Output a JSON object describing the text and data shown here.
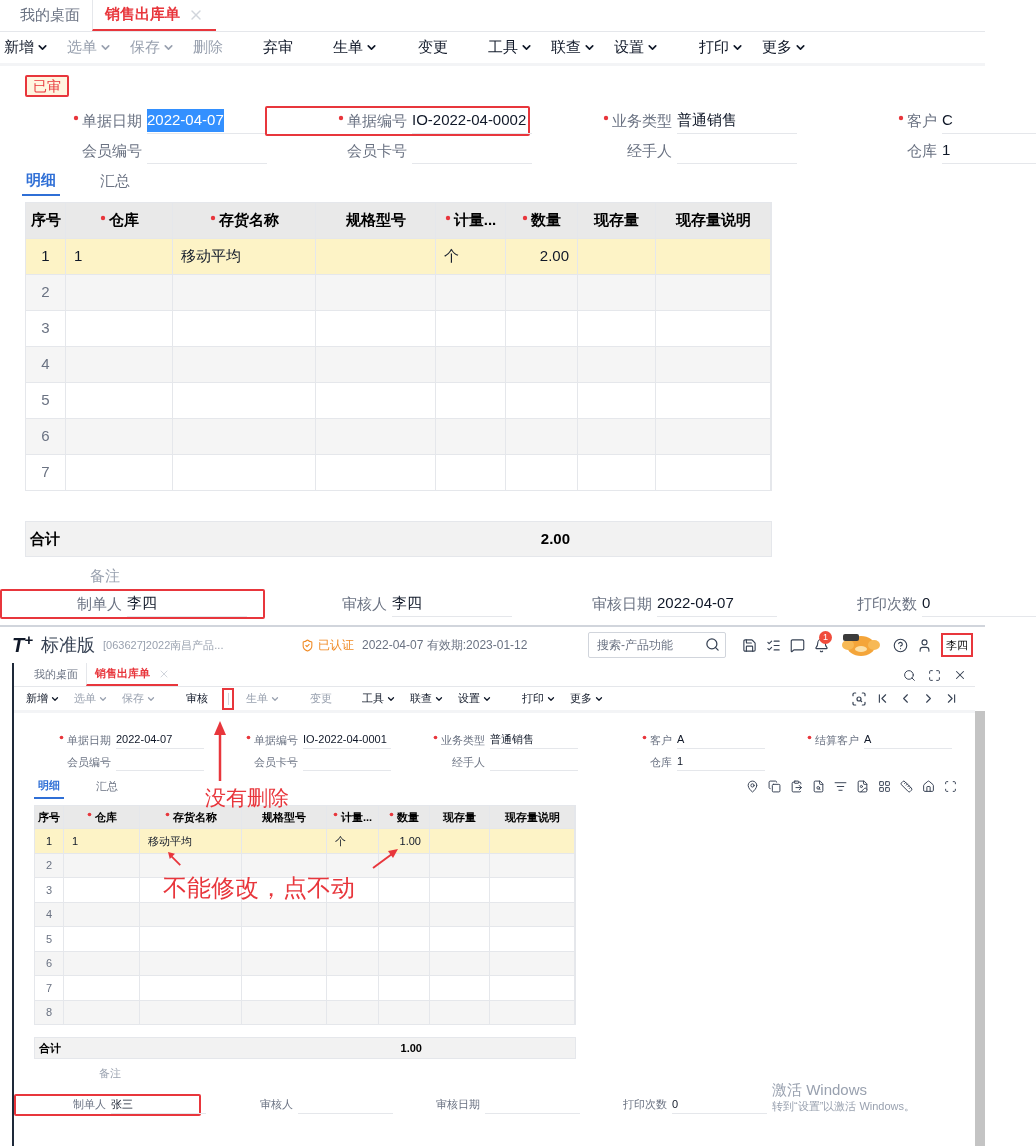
{
  "top": {
    "tabs": [
      {
        "label": "我的桌面",
        "selected": false
      },
      {
        "label": "销售出库单",
        "selected": true
      }
    ],
    "toolbar": [
      {
        "label": "新增",
        "dropdown": true,
        "disabled": false,
        "separator_before": false,
        "annotated": false
      },
      {
        "label": "选单",
        "dropdown": true,
        "disabled": true,
        "separator_before": false,
        "annotated": false
      },
      {
        "label": "保存",
        "dropdown": true,
        "disabled": true,
        "separator_before": false,
        "annotated": false
      },
      {
        "label": "删除",
        "dropdown": false,
        "disabled": true,
        "separator_before": false,
        "annotated": false
      },
      {
        "label": "弃审",
        "dropdown": false,
        "disabled": false,
        "separator_before": true,
        "annotated": false
      },
      {
        "label": "生单",
        "dropdown": true,
        "disabled": false,
        "separator_before": true,
        "annotated": false
      },
      {
        "label": "变更",
        "dropdown": false,
        "disabled": false,
        "separator_before": true,
        "annotated": false
      },
      {
        "label": "工具",
        "dropdown": true,
        "disabled": false,
        "separator_before": true,
        "annotated": false
      },
      {
        "label": "联查",
        "dropdown": true,
        "disabled": false,
        "separator_before": false,
        "annotated": false
      },
      {
        "label": "设置",
        "dropdown": true,
        "disabled": false,
        "separator_before": false,
        "annotated": false
      },
      {
        "label": "打印",
        "dropdown": true,
        "disabled": false,
        "separator_before": true,
        "annotated": false
      },
      {
        "label": "更多",
        "dropdown": true,
        "disabled": false,
        "separator_before": false,
        "annotated": false
      }
    ],
    "status": "已审",
    "fields": [
      [
        {
          "label": "单据日期",
          "value": "2022-04-07",
          "required": true,
          "annotated": false,
          "highlighted": true
        },
        {
          "label": "单据编号",
          "value": "IO-2022-04-0002",
          "required": true,
          "annotated": true,
          "highlighted": false
        },
        {
          "label": "业务类型",
          "value": "普通销售",
          "required": true,
          "annotated": false,
          "highlighted": false
        },
        {
          "label": "客户",
          "value": "C",
          "required": true,
          "annotated": false,
          "highlighted": false
        }
      ],
      [
        {
          "label": "会员编号",
          "required": false,
          "annotated": false,
          "highlighted": false
        },
        {
          "label": "会员卡号",
          "required": false,
          "annotated": false,
          "highlighted": false
        },
        {
          "label": "经手人",
          "required": false,
          "annotated": false,
          "highlighted": false
        },
        {
          "label": "仓库",
          "value": "1",
          "required": false,
          "annotated": false,
          "highlighted": false
        }
      ]
    ],
    "detail_tabs": [
      {
        "label": "明细",
        "selected": true
      },
      {
        "label": "汇总",
        "selected": false
      }
    ],
    "columns": [
      {
        "label": "序号",
        "required": false
      },
      {
        "label": "仓库",
        "required": true
      },
      {
        "label": "存货名称",
        "required": true
      },
      {
        "label": "规格型号",
        "required": false
      },
      {
        "label": "计量...",
        "required": true
      },
      {
        "label": "数量",
        "required": true
      },
      {
        "label": "现存量",
        "required": false
      },
      {
        "label": "现存量说明",
        "required": false
      }
    ],
    "rows": [
      {
        "no": "1",
        "warehouse": "1",
        "item": "移动平均",
        "unit": "个",
        "qty": "2.00",
        "selected": true
      },
      {
        "no": "2",
        "selected": false
      },
      {
        "no": "3",
        "selected": false
      },
      {
        "no": "4",
        "selected": false
      },
      {
        "no": "5",
        "selected": false
      },
      {
        "no": "6",
        "selected": false
      },
      {
        "no": "7",
        "selected": false
      }
    ],
    "total": {
      "label": "合计",
      "qty": "2.00"
    },
    "remark_label": "备注",
    "footer": [
      {
        "label": "制单人",
        "value": "李四",
        "required": false,
        "annotated": true,
        "highlighted": false
      },
      {
        "label": "审核人",
        "value": "李四",
        "required": false,
        "annotated": false,
        "highlighted": false
      },
      {
        "label": "审核日期",
        "value": "2022-04-07",
        "required": false,
        "annotated": false,
        "highlighted": false
      },
      {
        "label": "打印次数",
        "value": "0",
        "required": false,
        "annotated": false,
        "highlighted": false
      }
    ]
  },
  "bottom": {
    "header": {
      "logo": "T$^{+}$",
      "edition": "标准版",
      "company": "[063627]2022南昌产品...",
      "cert": "已认证",
      "validity": "2022-04-07 有效期:2023-01-12",
      "search_placeholder": "搜索-产品功能",
      "badge": "1",
      "user": "李四",
      "user_annotated": true
    },
    "tabs": [
      {
        "label": "我的桌面",
        "selected": false
      },
      {
        "label": "销售出库单",
        "selected": true
      }
    ],
    "toolbar": [
      {
        "label": "新增",
        "dropdown": true,
        "disabled": false,
        "separator_before": false,
        "annotated": false
      },
      {
        "label": "选单",
        "dropdown": true,
        "disabled": true,
        "separator_before": false,
        "annotated": false
      },
      {
        "label": "保存",
        "dropdown": true,
        "disabled": true,
        "separator_before": false,
        "annotated": false
      },
      {
        "label": "审核",
        "dropdown": false,
        "disabled": false,
        "separator_before": true,
        "annotated": false
      },
      {
        "label": "生单",
        "dropdown": true,
        "disabled": true,
        "separator_before": true,
        "annotated": true
      },
      {
        "label": "变更",
        "dropdown": false,
        "disabled": true,
        "separator_before": true,
        "annotated": false
      },
      {
        "label": "工具",
        "dropdown": true,
        "disabled": false,
        "separator_before": true,
        "annotated": false
      },
      {
        "label": "联查",
        "dropdown": true,
        "disabled": false,
        "separator_before": false,
        "annotated": false
      },
      {
        "label": "设置",
        "dropdown": true,
        "disabled": false,
        "separator_before": false,
        "annotated": false
      },
      {
        "label": "打印",
        "dropdown": true,
        "disabled": false,
        "separator_before": true,
        "annotated": false
      },
      {
        "label": "更多",
        "dropdown": true,
        "disabled": false,
        "separator_before": false,
        "annotated": false
      }
    ],
    "fields": [
      [
        {
          "label": "单据日期",
          "value": "2022-04-07",
          "required": true,
          "annotated": false,
          "highlighted": false
        },
        {
          "label": "单据编号",
          "value": "IO-2022-04-0001",
          "required": true,
          "annotated": false,
          "highlighted": false
        },
        {
          "label": "业务类型",
          "value": "普通销售",
          "required": true,
          "annotated": false,
          "highlighted": false
        },
        {
          "label": "客户",
          "value": "A",
          "required": true,
          "annotated": false,
          "highlighted": false
        },
        {
          "label": "结算客户",
          "value": "A",
          "required": true,
          "annotated": false,
          "highlighted": false
        }
      ],
      [
        {
          "label": "会员编号",
          "required": false,
          "annotated": false,
          "highlighted": false
        },
        {
          "label": "会员卡号",
          "required": false,
          "annotated": false,
          "highlighted": false
        },
        {
          "label": "经手人",
          "required": false,
          "annotated": false,
          "highlighted": false
        },
        {
          "label": "仓库",
          "value": "1",
          "required": false,
          "annotated": false,
          "highlighted": false
        }
      ]
    ],
    "detail_tabs": [
      {
        "label": "明细",
        "selected": true
      },
      {
        "label": "汇总",
        "selected": false
      }
    ],
    "columns": [
      {
        "label": "序号",
        "required": false
      },
      {
        "label": "仓库",
        "required": true
      },
      {
        "label": "存货名称",
        "required": true
      },
      {
        "label": "规格型号",
        "required": false
      },
      {
        "label": "计量...",
        "required": true
      },
      {
        "label": "数量",
        "required": true
      },
      {
        "label": "现存量",
        "required": false
      },
      {
        "label": "现存量说明",
        "required": false
      }
    ],
    "rows": [
      {
        "no": "1",
        "warehouse": "1",
        "item": "移动平均",
        "unit": "个",
        "qty": "1.00",
        "selected": true
      },
      {
        "no": "2",
        "selected": false
      },
      {
        "no": "3",
        "selected": false
      },
      {
        "no": "4",
        "selected": false
      },
      {
        "no": "5",
        "selected": false
      },
      {
        "no": "6",
        "selected": false
      },
      {
        "no": "7",
        "selected": false
      },
      {
        "no": "8",
        "selected": false
      }
    ],
    "total": {
      "label": "合计",
      "qty": "1.00"
    },
    "remark_label": "备注",
    "footer": [
      {
        "label": "制单人",
        "value": "张三",
        "required": false,
        "annotated": true,
        "highlighted": false
      },
      {
        "label": "审核人",
        "required": false,
        "annotated": false,
        "highlighted": false
      },
      {
        "label": "审核日期",
        "required": false,
        "annotated": false,
        "highlighted": false
      },
      {
        "label": "打印次数",
        "value": "0",
        "required": false,
        "annotated": false,
        "highlighted": false
      }
    ],
    "annotations": [
      {
        "kind": "no_delete",
        "text": "没有删除"
      },
      {
        "kind": "not_editable",
        "text": "不能修改，点不动"
      }
    ],
    "os_notice": {
      "title": "激活 Windows",
      "text": "转到“设置”以激活 Windows。"
    }
  }
}
